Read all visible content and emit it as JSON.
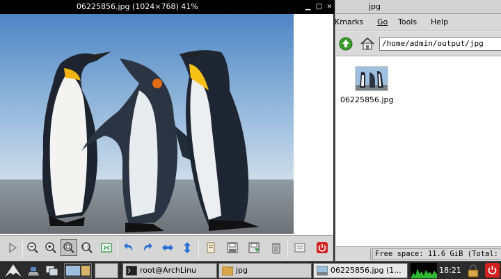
{
  "viewer": {
    "title": "06225856.jpg (1024×768) 41%",
    "buttons": {
      "minimize": "▁",
      "maximize": "□",
      "close": "×"
    },
    "toolbar": [
      {
        "name": "play-slideshow-button",
        "icon": "play-icon"
      },
      {
        "name": "zoom-out-button",
        "icon": "zoom-out-icon"
      },
      {
        "name": "zoom-in-button",
        "icon": "zoom-in-icon"
      },
      {
        "name": "zoom-fit-button",
        "icon": "zoom-fit-icon",
        "active": true
      },
      {
        "name": "zoom-original-button",
        "icon": "zoom-1to1-icon",
        "label": "1:1"
      },
      {
        "name": "fullscreen-button",
        "icon": "fullscreen-icon"
      },
      {
        "name": "rotate-left-button",
        "icon": "rotate-ccw-icon"
      },
      {
        "name": "rotate-right-button",
        "icon": "rotate-cw-icon"
      },
      {
        "name": "flip-horizontal-button",
        "icon": "flip-horizontal-icon"
      },
      {
        "name": "flip-vertical-button",
        "icon": "flip-vertical-icon"
      },
      {
        "name": "open-file-button",
        "icon": "open-icon"
      },
      {
        "name": "save-button",
        "icon": "save-icon"
      },
      {
        "name": "save-as-button",
        "icon": "save-as-icon"
      },
      {
        "name": "delete-button",
        "icon": "trash-icon"
      },
      {
        "name": "preferences-button",
        "icon": "preferences-icon"
      },
      {
        "name": "quit-button",
        "icon": "power-icon"
      }
    ]
  },
  "file_manager": {
    "title": "jpg",
    "menu": [
      "Kmarks",
      "Go",
      "Tools",
      "Help"
    ],
    "path": "/home/admin/output/jpg",
    "files": [
      {
        "name": "06225856.jpg"
      }
    ],
    "status": "Free space: 11.6 GiB (Total: 1"
  },
  "taskbar": {
    "tasks": [
      {
        "label": "root@ArchLinu",
        "icon": "terminal-icon"
      },
      {
        "label": "jpg",
        "icon": "folder-icon"
      },
      {
        "label": "06225856.jpg (1...",
        "icon": "image-icon"
      }
    ],
    "clock": "18:21"
  },
  "colors": {
    "accent_red": "#d32020",
    "accent_blue": "#2a6fd6",
    "accent_green": "#3a9a2a"
  }
}
